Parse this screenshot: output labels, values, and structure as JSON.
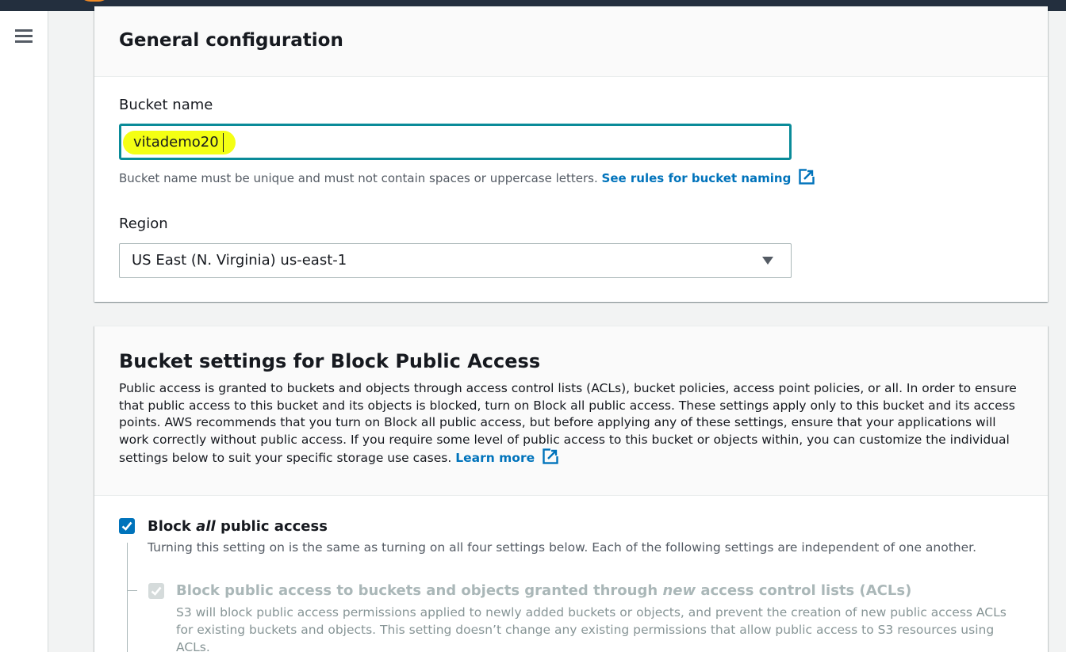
{
  "colors": {
    "topbar": "#232f3e",
    "accent_teal": "#0a8b99",
    "link_blue": "#0073bb",
    "highlight_yellow": "#f4ff14"
  },
  "nav": {
    "menu_icon": "hamburger-menu-icon"
  },
  "general": {
    "title": "General configuration",
    "bucket_name_label": "Bucket name",
    "bucket_name_value": "vitademo20",
    "hint_text": "Bucket name must be unique and must not contain spaces or uppercase letters.",
    "hint_link": "See rules for bucket naming",
    "hint_link_icon": "external-link-icon",
    "region_label": "Region",
    "region_value": "US East (N. Virginia) us-east-1",
    "region_icon": "caret-down-icon"
  },
  "block_public_access": {
    "title": "Bucket settings for Block Public Access",
    "description": "Public access is granted to buckets and objects through access control lists (ACLs), bucket policies, access point policies, or all. In order to ensure that public access to this bucket and its objects is blocked, turn on Block all public access. These settings apply only to this bucket and its access points. AWS recommends that you turn on Block all public access, but before applying any of these settings, ensure that your applications will work correctly without public access. If you require some level of public access to this bucket or objects within, you can customize the individual settings below to suit your specific storage use cases.",
    "learn_more": "Learn more",
    "learn_more_icon": "external-link-icon",
    "block_all": {
      "checked": true,
      "title_prefix": "Block ",
      "title_emphasis": "all",
      "title_suffix": " public access",
      "description": "Turning this setting on is the same as turning on all four settings below. Each of the following settings are independent of one another."
    },
    "acl_new": {
      "checked": true,
      "disabled": true,
      "title_prefix": "Block public access to buckets and objects granted through ",
      "title_emphasis": "new",
      "title_suffix": " access control lists (ACLs)",
      "description": "S3 will block public access permissions applied to newly added buckets or objects, and prevent the creation of new public access ACLs for existing buckets and objects. This setting doesn’t change any existing permissions that allow public access to S3 resources using ACLs."
    }
  }
}
